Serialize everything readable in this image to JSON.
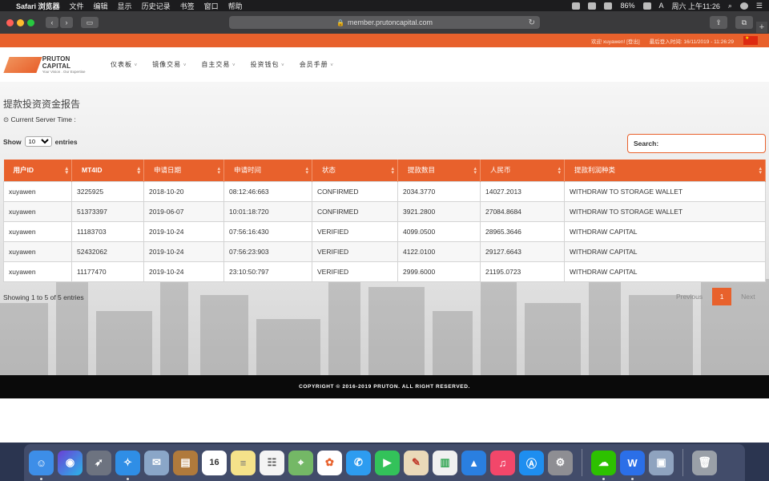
{
  "menubar": {
    "app": "Safari 浏览器",
    "items": [
      "文件",
      "编辑",
      "显示",
      "历史记录",
      "书签",
      "窗口",
      "帮助"
    ],
    "battery": "86%",
    "input_method": "A",
    "clock": "周六 上午11:26"
  },
  "browser": {
    "url": "member.prutoncapital.com"
  },
  "topbar": {
    "welcome": "欢迎 xuyawen! [登出]",
    "last_login": "最后登入时间: 16/11/2019 - 11:26:29"
  },
  "nav": {
    "logo_name": "PRUTON CAPITAL",
    "logo_tagline": "Your Vision . Our Expertise",
    "items": [
      "仪表板",
      "镜像交易",
      "自主交易",
      "投资钱包",
      "会员手册"
    ]
  },
  "page": {
    "title": "提款投资资金报告",
    "server_time": "Current Server Time :",
    "show_label": "Show",
    "entries_value": "10",
    "entries_label": "entries",
    "search_label": "Search:",
    "info": "Showing 1 to 5 of 5 entries",
    "prev": "Previous",
    "current_page": "1",
    "next": "Next"
  },
  "table": {
    "headers": [
      "用户ID",
      "MT4ID",
      "申请日期",
      "申请时间",
      "状态",
      "提款数目",
      "人民币",
      "提款利润种类"
    ],
    "rows": [
      [
        "xuyawen",
        "3225925",
        "2018-10-20",
        "08:12:46:663",
        "CONFIRMED",
        "2034.3770",
        "14027.2013",
        "WITHDRAW TO STORAGE WALLET"
      ],
      [
        "xuyawen",
        "51373397",
        "2019-06-07",
        "10:01:18:720",
        "CONFIRMED",
        "3921.2800",
        "27084.8684",
        "WITHDRAW TO STORAGE WALLET"
      ],
      [
        "xuyawen",
        "11183703",
        "2019-10-24",
        "07:56:16:430",
        "VERIFIED",
        "4099.0500",
        "28965.3646",
        "WITHDRAW CAPITAL"
      ],
      [
        "xuyawen",
        "52432062",
        "2019-10-24",
        "07:56:23:903",
        "VERIFIED",
        "4122.0100",
        "29127.6643",
        "WITHDRAW CAPITAL"
      ],
      [
        "xuyawen",
        "11177470",
        "2019-10-24",
        "23:10:50:797",
        "VERIFIED",
        "2999.6000",
        "21195.0723",
        "WITHDRAW CAPITAL"
      ]
    ]
  },
  "footer": {
    "copyright": "COPYRIGHT © 2016-2019 PRUTON. ALL RIGHT RESERVED."
  },
  "dock": {
    "calendar_day": "16"
  },
  "colors": {
    "accent": "#e8612c",
    "footer_bg": "#0a0a0a"
  }
}
